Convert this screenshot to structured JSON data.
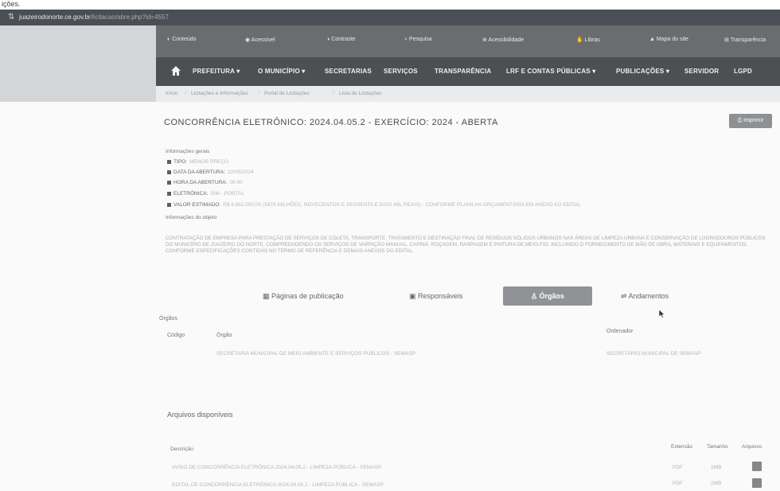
{
  "above_text": "ições.",
  "browser": {
    "url_domain": "juazeirodonorte.ce.gov.br",
    "url_path": "/licitacao/abre.php?id=4557"
  },
  "acc_bar": {
    "items": [
      "Conteúdo",
      "Acessível",
      "Contraste",
      "Pesquisa",
      "Acessibilidade",
      "Libras",
      "Mapa do site",
      "Transparência"
    ]
  },
  "main_nav": {
    "items": [
      "PREFEITURA ▾",
      "O MUNICÍPIO ▾",
      "SECRETARIAS",
      "SERVIÇOS",
      "TRANSPARÊNCIA",
      "LRF E CONTAS PÚBLICAS ▾",
      "PUBLICAÇÕES ▾",
      "SERVIDOR",
      "LGPD"
    ]
  },
  "breadcrumb": [
    "Início",
    "Licitações e Informações",
    "Portal de Licitações",
    "Lista de Licitações"
  ],
  "page": {
    "title": "CONCORRÊNCIA ELETRÔNICO: 2024.04.05.2 - EXERCÍCIO: 2024 - ABERTA",
    "print_label": "Imprimir"
  },
  "general_info": {
    "heading": "Informações gerais",
    "items": [
      {
        "key": "TIPO:",
        "value": "MENOR PREÇO"
      },
      {
        "key": "DATA DA ABERTURA:",
        "value": "22/05/2024"
      },
      {
        "key": "HORA DA ABERTURA:",
        "value": "09:00"
      },
      {
        "key": "ELETRÔNICA:",
        "value": "SIM - PORTAL"
      },
      {
        "key": "VALOR ESTIMADO:",
        "value": "R$ 6.962.000,00 (SEIS MILHÕES, NOVECENTOS E SESSENTA E DOIS MIL REAIS) - CONFORME PLANILHA ORÇAMENTÁRIA EM ANEXO AO EDITAL"
      }
    ]
  },
  "object_info": {
    "heading": "Informações do objeto",
    "text": "CONTRATAÇÃO DE EMPRESA PARA PRESTAÇÃO DE SERVIÇOS DE COLETA, TRANSPORTE, TRATAMENTO E DESTINAÇÃO FINAL DE RESÍDUOS SÓLIDOS URBANOS NAS ÁREAS DE LIMPEZA URBANA E CONSERVAÇÃO DE LOGRADOUROS PÚBLICOS DO MUNICÍPIO DE JUAZEIRO DO NORTE, COMPREENDENDO OS SERVIÇOS DE VARRIÇÃO MANUAL, CAPINA, ROÇAGEM, RASPAGEM E PINTURA DE MEIO-FIO, INCLUINDO O FORNECIMENTO DE MÃO DE OBRA, MATERIAIS E EQUIPAMENTOS, CONFORME ESPECIFICAÇÕES CONTIDAS NO TERMO DE REFERÊNCIA E DEMAIS ANEXOS DO EDITAL."
  },
  "tabs": [
    "Páginas de publicação",
    "Responsáveis",
    "Órgãos",
    "Andamentos"
  ],
  "orgaos": {
    "heading": "Órgãos",
    "columns": [
      "Código",
      "Órgão",
      "Ordenador"
    ],
    "rows": [
      {
        "code": "",
        "orgao": "SECRETARIA MUNICIPAL DE MEIO AMBIENTE E SERVIÇOS PÚBLICOS - SEMASP",
        "ordenador": "SECRETÁRIO MUNICIPAL DE SEMASP"
      }
    ]
  },
  "files": {
    "heading": "Arquivos disponíveis",
    "columns": [
      "Descrição",
      "Extensão",
      "Tamanho",
      "Arquivos"
    ],
    "rows": [
      {
        "desc": "AVISO DE CONCORRÊNCIA ELETRÔNICA 2024.04.05.2 - LIMPEZA PÚBLICA - SEMASP",
        "ext": "PDF",
        "size": "1MB"
      },
      {
        "desc": "EDITAL DE CONCORRÊNCIA ELETRÔNICA 2024.04.05.2 - LIMPEZA PÚBLICA - SEMASP",
        "ext": "PDF",
        "size": "2MB"
      }
    ]
  },
  "colors": {
    "nav_bg": "#4d4f52",
    "acc_bar_bg": "#6a6c6e",
    "active_tab_bg": "#909295",
    "page_bg": "#fafafa"
  }
}
